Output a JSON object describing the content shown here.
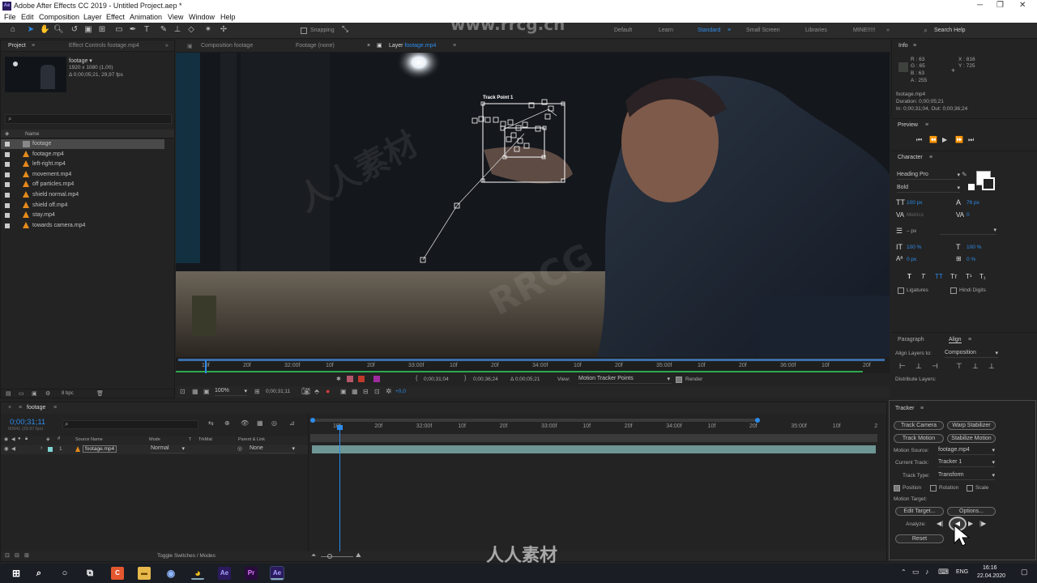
{
  "window": {
    "title": "Adobe After Effects CC 2019 - Untitled Project.aep *",
    "app_icon": "Ae"
  },
  "menu": [
    "File",
    "Edit",
    "Composition",
    "Layer",
    "Effect",
    "Animation",
    "View",
    "Window",
    "Help"
  ],
  "toolbar": {
    "snapping": "Snapping",
    "workspaces": [
      "Default",
      "Learn",
      "Standard",
      "Small Screen",
      "Libraries",
      "MINE!!!!!"
    ],
    "active_workspace": "Standard",
    "search_placeholder": "Search Help"
  },
  "project_panel": {
    "tab": "Project",
    "effect_controls_tab": "Effect Controls footage.mp4",
    "item_name": "footage ▾",
    "item_dims": "1920 x 1080 (1,00)",
    "item_dur": "Δ 0;00;05;21, 29,97 fps",
    "col_name": "Name",
    "items": [
      {
        "name": "footage",
        "type": "comp"
      },
      {
        "name": "footage.mp4",
        "type": "footage"
      },
      {
        "name": "left-right.mp4",
        "type": "footage"
      },
      {
        "name": "movement.mp4",
        "type": "footage"
      },
      {
        "name": "off particles.mp4",
        "type": "footage"
      },
      {
        "name": "shield normal.mp4",
        "type": "footage"
      },
      {
        "name": "shield off.mp4",
        "type": "footage"
      },
      {
        "name": "stay.mp4",
        "type": "footage"
      },
      {
        "name": "towards camera.mp4",
        "type": "footage"
      }
    ],
    "bpc": "8 bpc"
  },
  "viewer_tabs": {
    "comp_tab": "Composition footage",
    "footage_tab": "Footage (none)",
    "layer_tab_prefix": "Layer",
    "layer_tab_name": "footage.mp4"
  },
  "track_point_label": "Track Point 1",
  "layer_ruler": {
    "ticks": [
      "10f",
      "20f",
      "32:00f",
      "10f",
      "20f",
      "33:00f",
      "10f",
      "20f",
      "34:00f",
      "10f",
      "20f",
      "35:00f",
      "10f",
      "20f",
      "36:00f",
      "10f",
      "20f"
    ],
    "in_time": "0;00;31;04",
    "out_time": "0;00;36;24",
    "duration": "Δ 0;00;05;21",
    "view_label": "View:",
    "view_value": "Motion Tracker Points",
    "render_label": "Render"
  },
  "viewer_footer": {
    "zoom": "100%",
    "timecode": "0;00;31;11",
    "exposure": "+0,0"
  },
  "timeline": {
    "tab": "footage",
    "timecode": "0;00;31;11",
    "fps": "00941 (29.97 fps)",
    "cols": {
      "source": "Source Name",
      "mode": "Mode",
      "t": "T",
      "trkmat": "TrkMat",
      "parent": "Parent & Link"
    },
    "layer": {
      "num": "1",
      "name": "footage.mp4",
      "mode": "Normal",
      "parent": "None"
    },
    "ruler": [
      "10f",
      "20f",
      "32:00f",
      "10f",
      "20f",
      "33:00f",
      "10f",
      "20f",
      "34:00f",
      "10f",
      "20f",
      "35:00f",
      "10f",
      "2"
    ],
    "toggle": "Toggle Switches / Modes"
  },
  "info_panel": {
    "title": "Info",
    "r": "R : 63",
    "g": "G : 65",
    "b": "B : 63",
    "a": "A : 255",
    "x": "X : 816",
    "y": "Y : 725",
    "file": "footage.mp4",
    "duration": "Duration: 0;00;05;21",
    "inout": "In: 0;00;31;04, Out: 0;00;36;24"
  },
  "preview_panel": {
    "title": "Preview"
  },
  "character_panel": {
    "title": "Character",
    "font": "Heading Pro",
    "style": "Bold",
    "size": "100 px",
    "leading": "76 px",
    "kerning": "Metrics",
    "tracking": "0",
    "stroke": "– px",
    "vscale": "100 %",
    "hscale": "100 %",
    "baseline": "0 px",
    "tsume": "0 %",
    "styles": [
      "T",
      "T",
      "TT",
      "Tт",
      "T¹",
      "T₁"
    ],
    "ligatures": "Ligatures",
    "hindi": "Hindi Digits"
  },
  "align_panel": {
    "tabs": [
      "Paragraph",
      "Align"
    ],
    "align_to_label": "Align Layers to:",
    "align_to": "Composition",
    "distribute": "Distribute Layers:"
  },
  "tracker_panel": {
    "title": "Tracker",
    "track_camera": "Track Camera",
    "warp_stabilizer": "Warp Stabilizer",
    "track_motion": "Track Motion",
    "stabilize_motion": "Stabilize Motion",
    "motion_source_label": "Motion Source:",
    "motion_source": "footage.mp4",
    "current_track_label": "Current Track:",
    "current_track": "Tracker 1",
    "track_type_label": "Track Type:",
    "track_type": "Transform",
    "position": "Position",
    "rotation": "Rotation",
    "scale": "Scale",
    "motion_target": "Motion Target:",
    "edit_target": "Edit Target...",
    "options": "Options...",
    "analyze": "Analyze:",
    "reset": "Reset"
  },
  "taskbar": {
    "lang": "ENG",
    "time": "16:16",
    "date": "22.04.2020"
  },
  "watermarks": [
    "www.rrcg.cn",
    "RRCG",
    "人人素材"
  ]
}
